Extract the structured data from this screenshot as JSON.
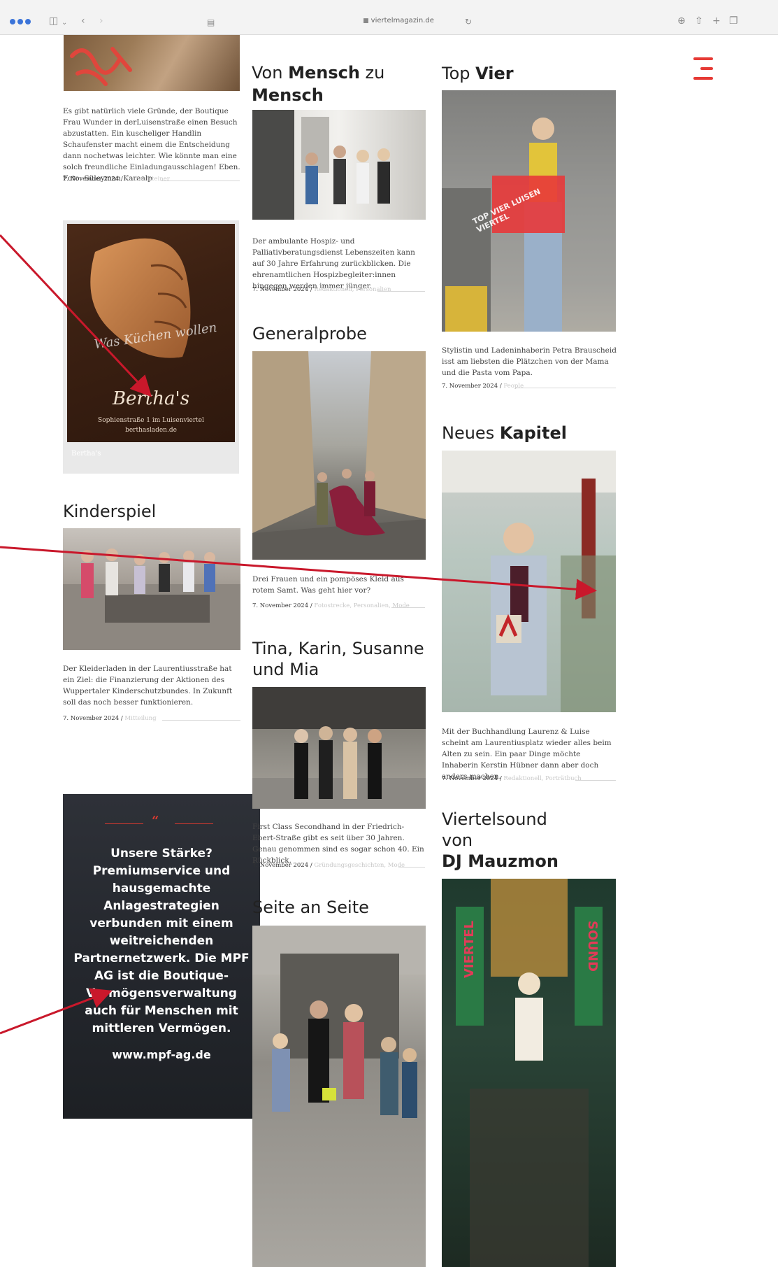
{
  "browser": {
    "url": "viertelmagazin.de"
  },
  "col_left": {
    "post1": {
      "excerpt": "Es gibt natürlich viele Gründe, der Boutique Frau Wunder in derLuisenstraße einen Besuch abzustatten. Ein kuscheliger Handlin Schaufenster macht einem die Entscheidung dann nochetwas leichter. Wie könnte man eine solch freundliche Einladungausschlagen! Eben. Foto: Süleyman Karaalp",
      "date": "7. November 2024",
      "category": "Fachaufsteiner"
    },
    "ad_bertha": {
      "tagline": "Was Küchen wollen",
      "brand": "Bertha's",
      "address": "Sophienstraße 1 im Luisenviertel",
      "website": "berthasladen.de",
      "caption": "Bertha's"
    },
    "post2": {
      "title": "Kinderspiel",
      "excerpt": "Der Kleiderladen in der Laurentiusstraße hat ein Ziel: die Finanzierung der Aktionen des Wuppertaler Kinderschutzbundes. In Zukunft soll das noch besser funktionieren.",
      "date": "7. November 2024",
      "category": "Mitteilung"
    },
    "ad_mpf": {
      "quote": "“",
      "text": "Unsere Stärke? Premiumservice und hausgemachte Anlagestrategien verbunden mit einem weitreichenden Partnernetzwerk. Die MPF AG ist die Boutique-Vermögensverwaltung auch für Menschen mit mittleren Vermögen.",
      "url": "www.mpf-ag.de"
    }
  },
  "col_mid": {
    "post1": {
      "title_a": "Von ",
      "title_b": "Mensch",
      "title_c": " zu",
      "title_d": "Mensch",
      "excerpt": "Der ambulante Hospiz- und Palliativberatungsdienst Lebenszeiten kann auf 30 Jahre Erfahrung zurückblicken. Die ehrenamtlichen Hospizbegleiter:innen hingegen werden immer jünger.",
      "date": "7. November 2024",
      "category": "Redaktionell, Personalien"
    },
    "post2": {
      "title": "Generalprobe",
      "excerpt": "Drei Frauen und ein pompöses Kleid aus rotem Samt. Was geht hier vor?",
      "date": "7. November 2024",
      "category": "Fotostrecke, Personalien, Mode"
    },
    "post3": {
      "title_a": "Tina, Karin, Susanne",
      "title_b": "und Mia",
      "excerpt": "First Class Secondhand in der Friedrich-Ebert-Straße gibt es seit über 30 Jahren. Genau genommen sind es sogar schon 40. Ein Rückblick.",
      "date": "7. November 2024",
      "category": "Gründungsgeschichten, Mode"
    },
    "post4": {
      "title": "Seite an Seite"
    }
  },
  "col_right": {
    "post1": {
      "title_a": "Top ",
      "title_b": "Vier",
      "excerpt": "Stylistin und Ladeninhaberin Petra Brauscheid isst am liebsten die Plätzchen von der Mama und die Pasta vom Papa.",
      "date": "7. November 2024",
      "category": "People",
      "overlay": "TOP VIER LUISEN VIERTEL"
    },
    "post2": {
      "title_a": "Neues ",
      "title_b": "Kapitel",
      "excerpt": "Mit der Buchhandlung Laurenz & Luise scheint am Laurentiusplatz wieder alles beim Alten zu sein. Ein paar Dinge möchte Inhaberin Kerstin Hübner dann aber doch anders machen.",
      "date": "7. November 2024",
      "category": "Redaktionell, Porträtbuch"
    },
    "post3": {
      "title_a": "Viertelsound",
      "title_b": "von",
      "title_c": "DJ Mauzmon",
      "sign_left": "VIERTEL",
      "sign_right": "SOUND"
    }
  },
  "colors": {
    "accent": "#e63a35",
    "arrow": "#c9182b"
  }
}
